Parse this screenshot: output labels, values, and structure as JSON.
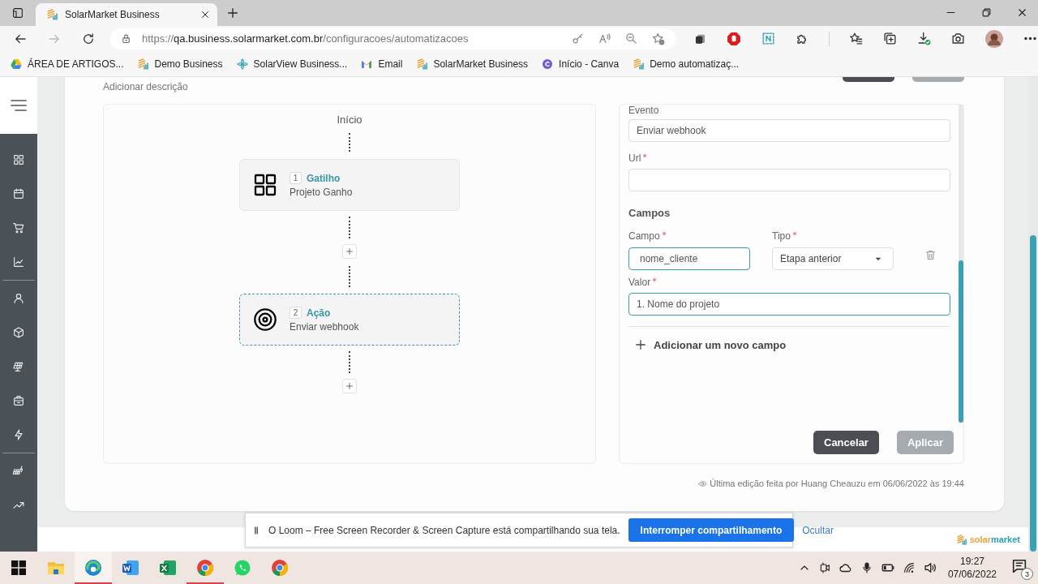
{
  "browser": {
    "tabs": [
      {
        "title": "SolarMarket Business",
        "selected": true
      }
    ],
    "address": {
      "scheme": "https://",
      "host": "qa.business.solarmarket.com.br",
      "path": "/configuracoes/automatizacoes"
    },
    "bookmarks": [
      {
        "kind": "drive",
        "label": "ÁREA DE ARTIGOS..."
      },
      {
        "kind": "stack",
        "label": "Demo Business"
      },
      {
        "kind": "flower",
        "label": "SolarView Business..."
      },
      {
        "kind": "mail",
        "label": "Email"
      },
      {
        "kind": "stack",
        "label": "SolarMarket Business"
      },
      {
        "kind": "circle",
        "label": "Início - Canva"
      },
      {
        "kind": "stack",
        "label": "Demo automatizaç..."
      }
    ]
  },
  "page": {
    "description_link": "Adicionar descrição",
    "flow": {
      "start": "Início",
      "nodes": [
        {
          "kind": "trigger",
          "number": "1",
          "title": "Gatilho",
          "subtitle": "Projeto Ganho",
          "selected": false
        },
        {
          "kind": "action",
          "number": "2",
          "title": "Ação",
          "subtitle": "Enviar webhook",
          "selected": true
        }
      ]
    },
    "form": {
      "event": {
        "label": "Evento",
        "value": "Enviar webhook"
      },
      "url": {
        "label": "Url",
        "required": true
      },
      "section": "Campos",
      "fields": [
        {
          "campo": {
            "label": "Campo",
            "required": true,
            "value": "nome_cliente",
            "focused": true
          },
          "tipo": {
            "label": "Tipo",
            "required": true,
            "value": "Etapa anterior"
          },
          "valor": {
            "label": "Valor",
            "required": true,
            "value": "1. Nome do projeto",
            "focused": true
          }
        }
      ],
      "add_field": "Adicionar um novo campo",
      "buttons": [
        {
          "label": "Cancelar",
          "disabled": false
        },
        {
          "label": "Aplicar",
          "disabled": true
        }
      ]
    },
    "footer": "Última edição feita por Huang Cheauzu em 06/06/2022 às 19:44",
    "logo": {
      "parts": [
        "solar",
        "market"
      ]
    }
  },
  "loom": {
    "message": "O Loom – Free Screen Recorder & Screen Capture está compartilhando sua tela.",
    "stop_button": "Interromper compartilhamento",
    "hide_link": "Ocultar"
  },
  "taskbar": {
    "apps": [
      {
        "kind": "start",
        "running": false,
        "selected": false
      },
      {
        "kind": "folder",
        "running": false,
        "selected": false
      },
      {
        "kind": "edge",
        "running": true,
        "selected": true
      },
      {
        "kind": "word",
        "running": false,
        "selected": false
      },
      {
        "kind": "excel",
        "running": false,
        "selected": false
      },
      {
        "kind": "chrome-h",
        "running": true,
        "selected": false
      },
      {
        "kind": "whatsapp",
        "running": false,
        "selected": false
      },
      {
        "kind": "chrome",
        "running": false,
        "selected": false
      }
    ],
    "clock": {
      "time": "19:27",
      "date": "07/06/2022"
    },
    "notifications": {
      "count": "3"
    }
  }
}
